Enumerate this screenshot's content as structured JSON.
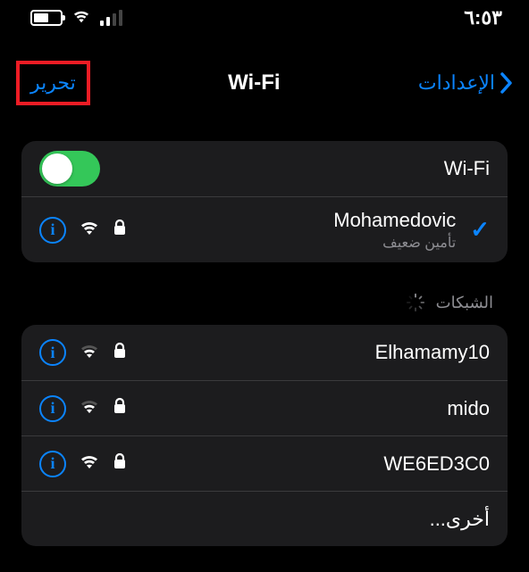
{
  "status": {
    "time": "٦:٥٣"
  },
  "nav": {
    "title": "Wi-Fi",
    "back": "الإعدادات",
    "edit": "تحرير"
  },
  "wifi_toggle": {
    "label": "Wi-Fi"
  },
  "connected": {
    "ssid": "Mohamedovic",
    "warning": "تأمين ضعيف"
  },
  "section_title": "الشبكات",
  "networks": [
    {
      "ssid": "Elhamamy10"
    },
    {
      "ssid": "mido"
    },
    {
      "ssid": "WE6ED3C0"
    }
  ],
  "other_label": "أخرى..."
}
